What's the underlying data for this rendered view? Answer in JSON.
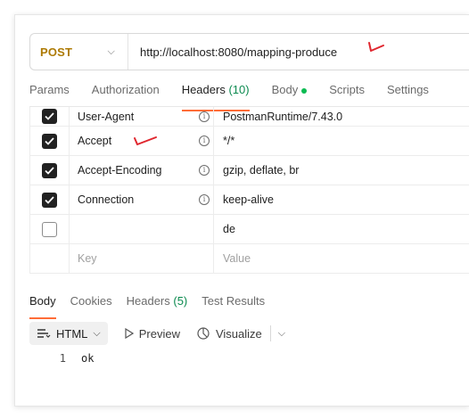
{
  "request": {
    "method": "POST",
    "url": "http://localhost:8080/mapping-produce"
  },
  "request_tabs": [
    {
      "label": "Params"
    },
    {
      "label": "Authorization"
    },
    {
      "label": "Headers",
      "count": "(10)"
    },
    {
      "label": "Body"
    },
    {
      "label": "Scripts"
    },
    {
      "label": "Settings"
    }
  ],
  "headers": [
    {
      "key": "User-Agent",
      "value": "PostmanRuntime/7.43.0",
      "checked": true
    },
    {
      "key": "Accept",
      "value": "*/*",
      "checked": true
    },
    {
      "key": "Accept-Encoding",
      "value": "gzip, deflate, br",
      "checked": true
    },
    {
      "key": "Connection",
      "value": "keep-alive",
      "checked": true
    },
    {
      "key": "",
      "value": "de",
      "checked": false
    }
  ],
  "placeholders": {
    "key": "Key",
    "value": "Value"
  },
  "response_tabs": [
    {
      "label": "Body"
    },
    {
      "label": "Cookies"
    },
    {
      "label": "Headers",
      "count": "(5)"
    },
    {
      "label": "Test Results"
    }
  ],
  "viewer": {
    "format": "HTML",
    "preview": "Preview",
    "visualize": "Visualize"
  },
  "response_body": [
    {
      "line": "1",
      "text": "ok"
    }
  ],
  "colors": {
    "method": "#ad7a03",
    "active_tab_underline": "#ff6c37",
    "count": "#0b8a4f",
    "annotation": "#e0262e"
  }
}
